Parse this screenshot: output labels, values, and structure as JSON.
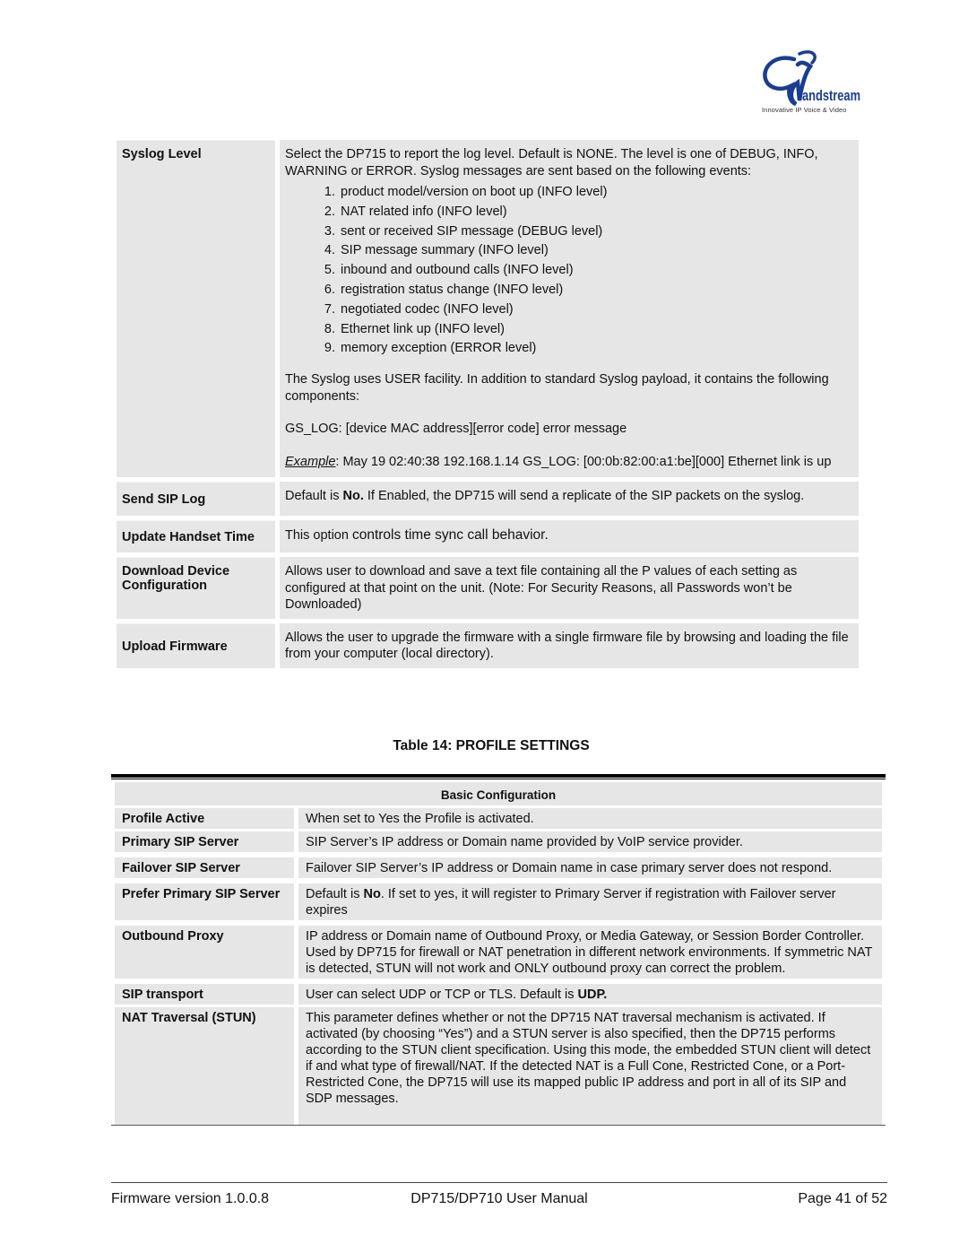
{
  "logo": {
    "brand": "Grandstream",
    "tagline": "Innovative IP Voice & Video",
    "brand_color": "#1a3d8f"
  },
  "table13": {
    "rows": [
      {
        "label": "Syslog Level",
        "intro": "Select the DP715   to report the log level. Default is NONE. The level is one of DEBUG, INFO, WARNING or ERROR. Syslog messages are sent based on the following events:",
        "events": [
          {
            "num": "1.",
            "text": "product model/version on boot up (INFO level)"
          },
          {
            "num": "2.",
            "text": "NAT related info (INFO level)"
          },
          {
            "num": "3.",
            "text": "sent or received SIP message (DEBUG level)"
          },
          {
            "num": "4.",
            "text": "SIP message summary (INFO level)"
          },
          {
            "num": "5.",
            "text": "inbound and outbound calls (INFO level)"
          },
          {
            "num": "6.",
            "text": "registration status change (INFO level)"
          },
          {
            "num": "7.",
            "text": "negotiated codec (INFO level)"
          },
          {
            "num": "8.",
            "text": "Ethernet link up (INFO level)"
          },
          {
            "num": "9.",
            "text": "memory exception (ERROR level)"
          }
        ],
        "facility": "The Syslog uses USER facility.  In addition to standard Syslog payload, it contains the following components:",
        "format": "GS_LOG: [device MAC address][error code] error message",
        "example_label": "Example",
        "example_text": ": May 19 02:40:38 192.168.1.14 GS_LOG: [00:0b:82:00:a1:be][000] Ethernet link is up"
      },
      {
        "label": "Send SIP Log",
        "pre": "Default is ",
        "bold": "No.",
        "post": " If Enabled, the DP715 will send a replicate of the SIP packets on the syslog."
      },
      {
        "label": "Update Handset Time",
        "pre": "This option ",
        "post": "controls time sync call behavior."
      },
      {
        "label": "Download Device Configuration",
        "text": "Allows user to download and save a text file containing all the P values of each setting as configured at that point on the unit. (Note: For Security Reasons, all Passwords won’t be Downloaded)"
      },
      {
        "label": "Upload Firmware",
        "text": "Allows the user to upgrade the firmware with a single firmware file by browsing and loading the file from your computer (local directory)."
      }
    ]
  },
  "table14": {
    "caption": "Table 14: PROFILE SETTINGS",
    "section": "Basic Configuration",
    "rows": [
      {
        "label": "Profile Active",
        "text": "When set to Yes the Profile is activated."
      },
      {
        "label": "Primary SIP Server",
        "text": "SIP Server’s IP address or Domain name provided by VoIP service provider."
      },
      {
        "label": "Failover SIP Server",
        "text": "Failover SIP Server’s IP address or Domain name in case primary server does not respond."
      },
      {
        "label": "Prefer Primary SIP Server",
        "pre": "Default is ",
        "bold": "No",
        "post": ". If set to yes, it will register to Primary Server if registration with Failover server expires"
      },
      {
        "label": "Outbound Proxy",
        "text": "IP address or Domain name of Outbound Proxy, or Media Gateway, or Session Border Controller. Used by DP715 for firewall or NAT penetration in different network environments.  If symmetric NAT is detected, STUN will not work and ONLY outbound proxy can correct the problem."
      },
      {
        "label": "SIP transport",
        "pre": "User can select UDP or TCP or TLS. Default is ",
        "bold": "UDP."
      },
      {
        "label": "NAT Traversal (STUN)",
        "text": "This parameter defines whether or not the DP715 NAT traversal mechanism is activated. If activated (by choosing “Yes”) and a STUN server is also specified, then the DP715 performs according to the STUN client specification. Using this mode, the embedded STUN client will detect if and what type of firewall/NAT.  If the detected NAT is a Full Cone, Restricted Cone, or a Port-Restricted Cone, the DP715 will use its mapped public IP address and port in all of its SIP and SDP messages."
      }
    ]
  },
  "footer": {
    "left": "Firmware version 1.0.0.8",
    "center": "DP715/DP710 User Manual",
    "right": "Page 41 of 52"
  }
}
